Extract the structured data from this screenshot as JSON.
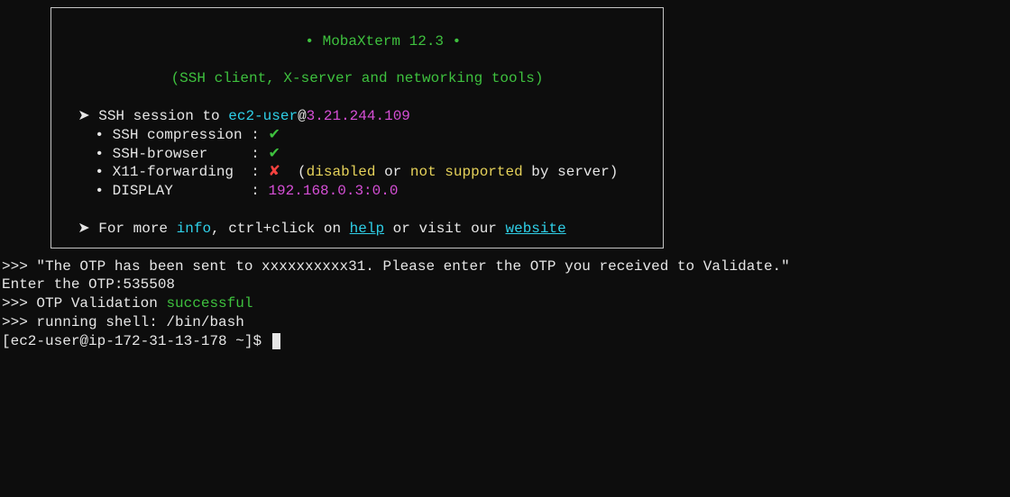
{
  "banner": {
    "title": "MobaXterm 12.3",
    "subtitle": "(SSH client, X-server and networking tools)",
    "session_prefix": "SSH session to ",
    "user": "ec2-user",
    "at": "@",
    "host": "3.21.244.109",
    "items": {
      "compression_label": "SSH compression : ",
      "compression_mark": "✔",
      "browser_label": "SSH-browser     : ",
      "browser_mark": "✔",
      "x11_label": "X11-forwarding  : ",
      "x11_mark": "✘",
      "x11_open": "  (",
      "x11_disabled": "disabled",
      "x11_or": " or ",
      "x11_not_supported": "not supported",
      "x11_close": " by server)",
      "display_label": "DISPLAY         : ",
      "display_value": "192.168.0.3:0.0"
    },
    "footer_prefix": "For more ",
    "footer_info": "info",
    "footer_mid1": ", ctrl+click on ",
    "footer_help": "help",
    "footer_mid2": " or visit our ",
    "footer_website": "website"
  },
  "output": {
    "line1a": ">>> \"The OTP has been sent to xxxxxxxxxx31. Please enter the OTP you received to Validate.\"",
    "line2": "Enter the OTP:535508",
    "line3a": ">>> OTP Validation ",
    "line3b": "successful",
    "line4": ">>> running shell: /bin/bash",
    "prompt": "[ec2-user@ip-172-31-13-178 ~]$ "
  }
}
